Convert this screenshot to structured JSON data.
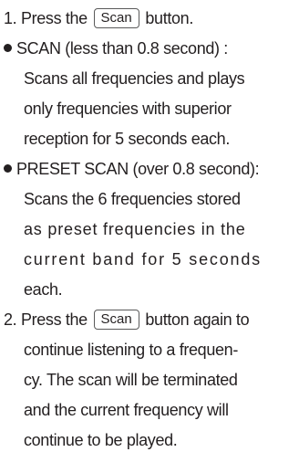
{
  "scan_button_label": "Scan",
  "step1": {
    "prefix": "1. Press the",
    "suffix": "button."
  },
  "bullets": [
    {
      "lead": "SCAN (less than 0.8 second) :",
      "lines": [
        "Scans all frequencies and plays",
        "only frequencies with superior",
        "reception for 5 seconds each."
      ]
    },
    {
      "lead": "PRESET SCAN (over 0.8 second):",
      "lines": [
        "Scans the 6 frequencies stored",
        "as preset frequencies in the",
        "current band for 5 seconds",
        "each."
      ]
    }
  ],
  "step2": {
    "prefix": "2. Press the",
    "suffix": "button again to",
    "lines": [
      "continue listening to a frequen-",
      "cy. The scan will be terminated",
      "and the current frequency will",
      "continue to be played."
    ]
  }
}
